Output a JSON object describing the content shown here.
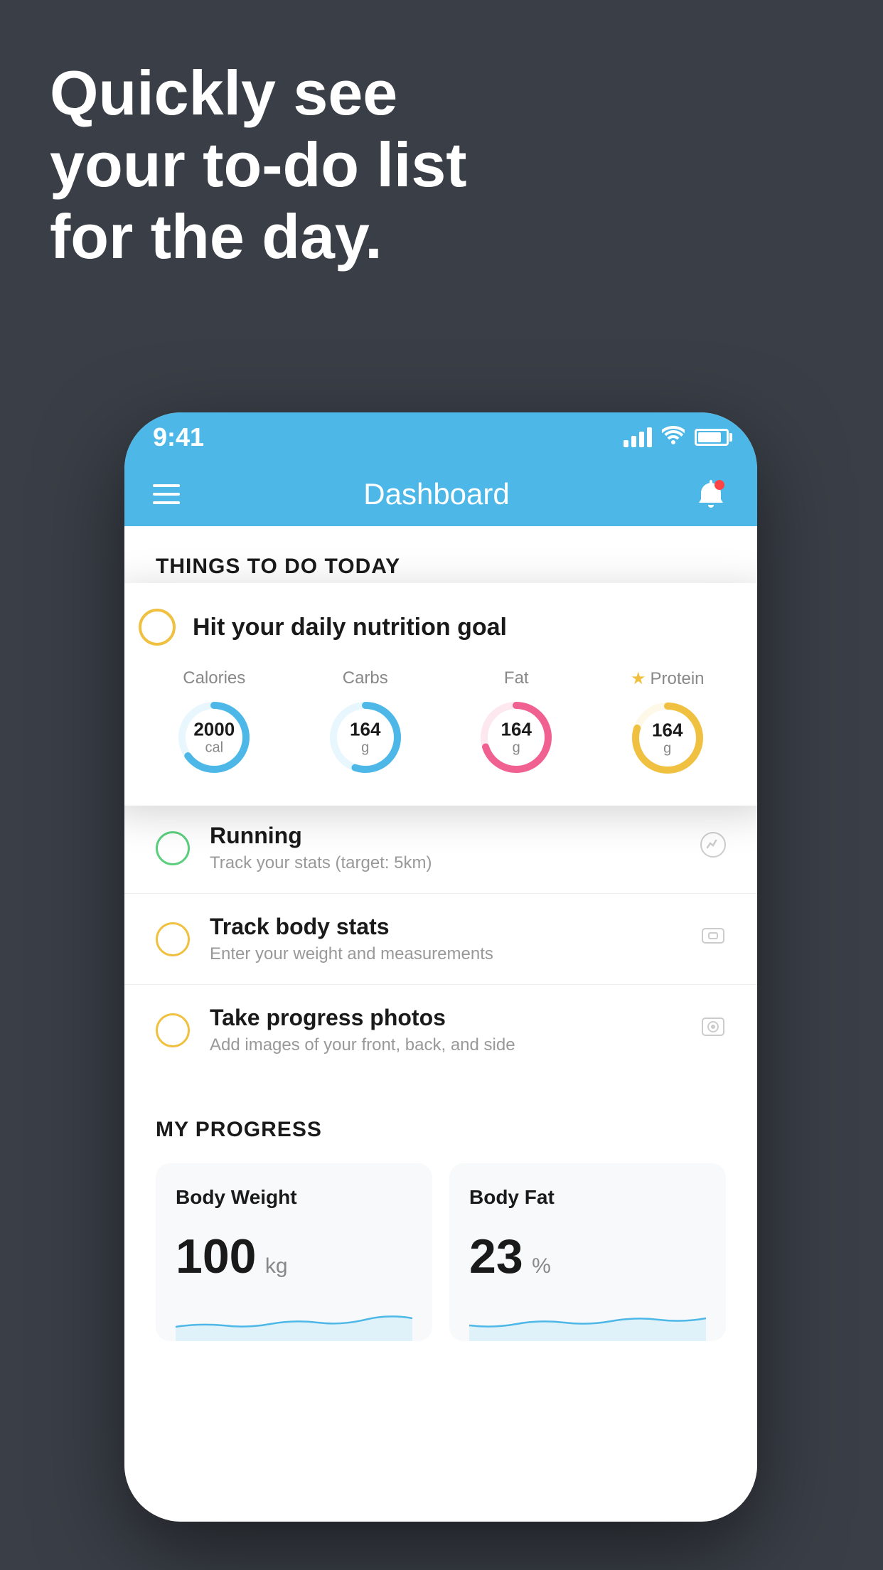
{
  "headline": {
    "line1": "Quickly see",
    "line2": "your to-do list",
    "line3": "for the day."
  },
  "status_bar": {
    "time": "9:41",
    "signal_bars": [
      10,
      16,
      22,
      28
    ],
    "battery_percent": 85
  },
  "header": {
    "title": "Dashboard",
    "menu_label": "Menu",
    "notification_label": "Notifications"
  },
  "things_section": {
    "title": "THINGS TO DO TODAY"
  },
  "nutrition_card": {
    "title": "Hit your daily nutrition goal",
    "macros": [
      {
        "label": "Calories",
        "value": "2000",
        "unit": "cal",
        "color": "#4db8e8",
        "track_color": "#e8f7fd",
        "percent": 65,
        "starred": false
      },
      {
        "label": "Carbs",
        "value": "164",
        "unit": "g",
        "color": "#4db8e8",
        "track_color": "#e8f7fd",
        "percent": 55,
        "starred": false
      },
      {
        "label": "Fat",
        "value": "164",
        "unit": "g",
        "color": "#f06090",
        "track_color": "#fde8ef",
        "percent": 70,
        "starred": false
      },
      {
        "label": "Protein",
        "value": "164",
        "unit": "g",
        "color": "#f0c040",
        "track_color": "#fef8e8",
        "percent": 80,
        "starred": true
      }
    ]
  },
  "todo_items": [
    {
      "title": "Running",
      "subtitle": "Track your stats (target: 5km)",
      "circle_color": "green",
      "icon": "👟"
    },
    {
      "title": "Track body stats",
      "subtitle": "Enter your weight and measurements",
      "circle_color": "yellow",
      "icon": "⚖️"
    },
    {
      "title": "Take progress photos",
      "subtitle": "Add images of your front, back, and side",
      "circle_color": "yellow",
      "icon": "🪪"
    }
  ],
  "progress_section": {
    "title": "MY PROGRESS",
    "cards": [
      {
        "title": "Body Weight",
        "value": "100",
        "unit": "kg"
      },
      {
        "title": "Body Fat",
        "value": "23",
        "unit": "%"
      }
    ]
  }
}
